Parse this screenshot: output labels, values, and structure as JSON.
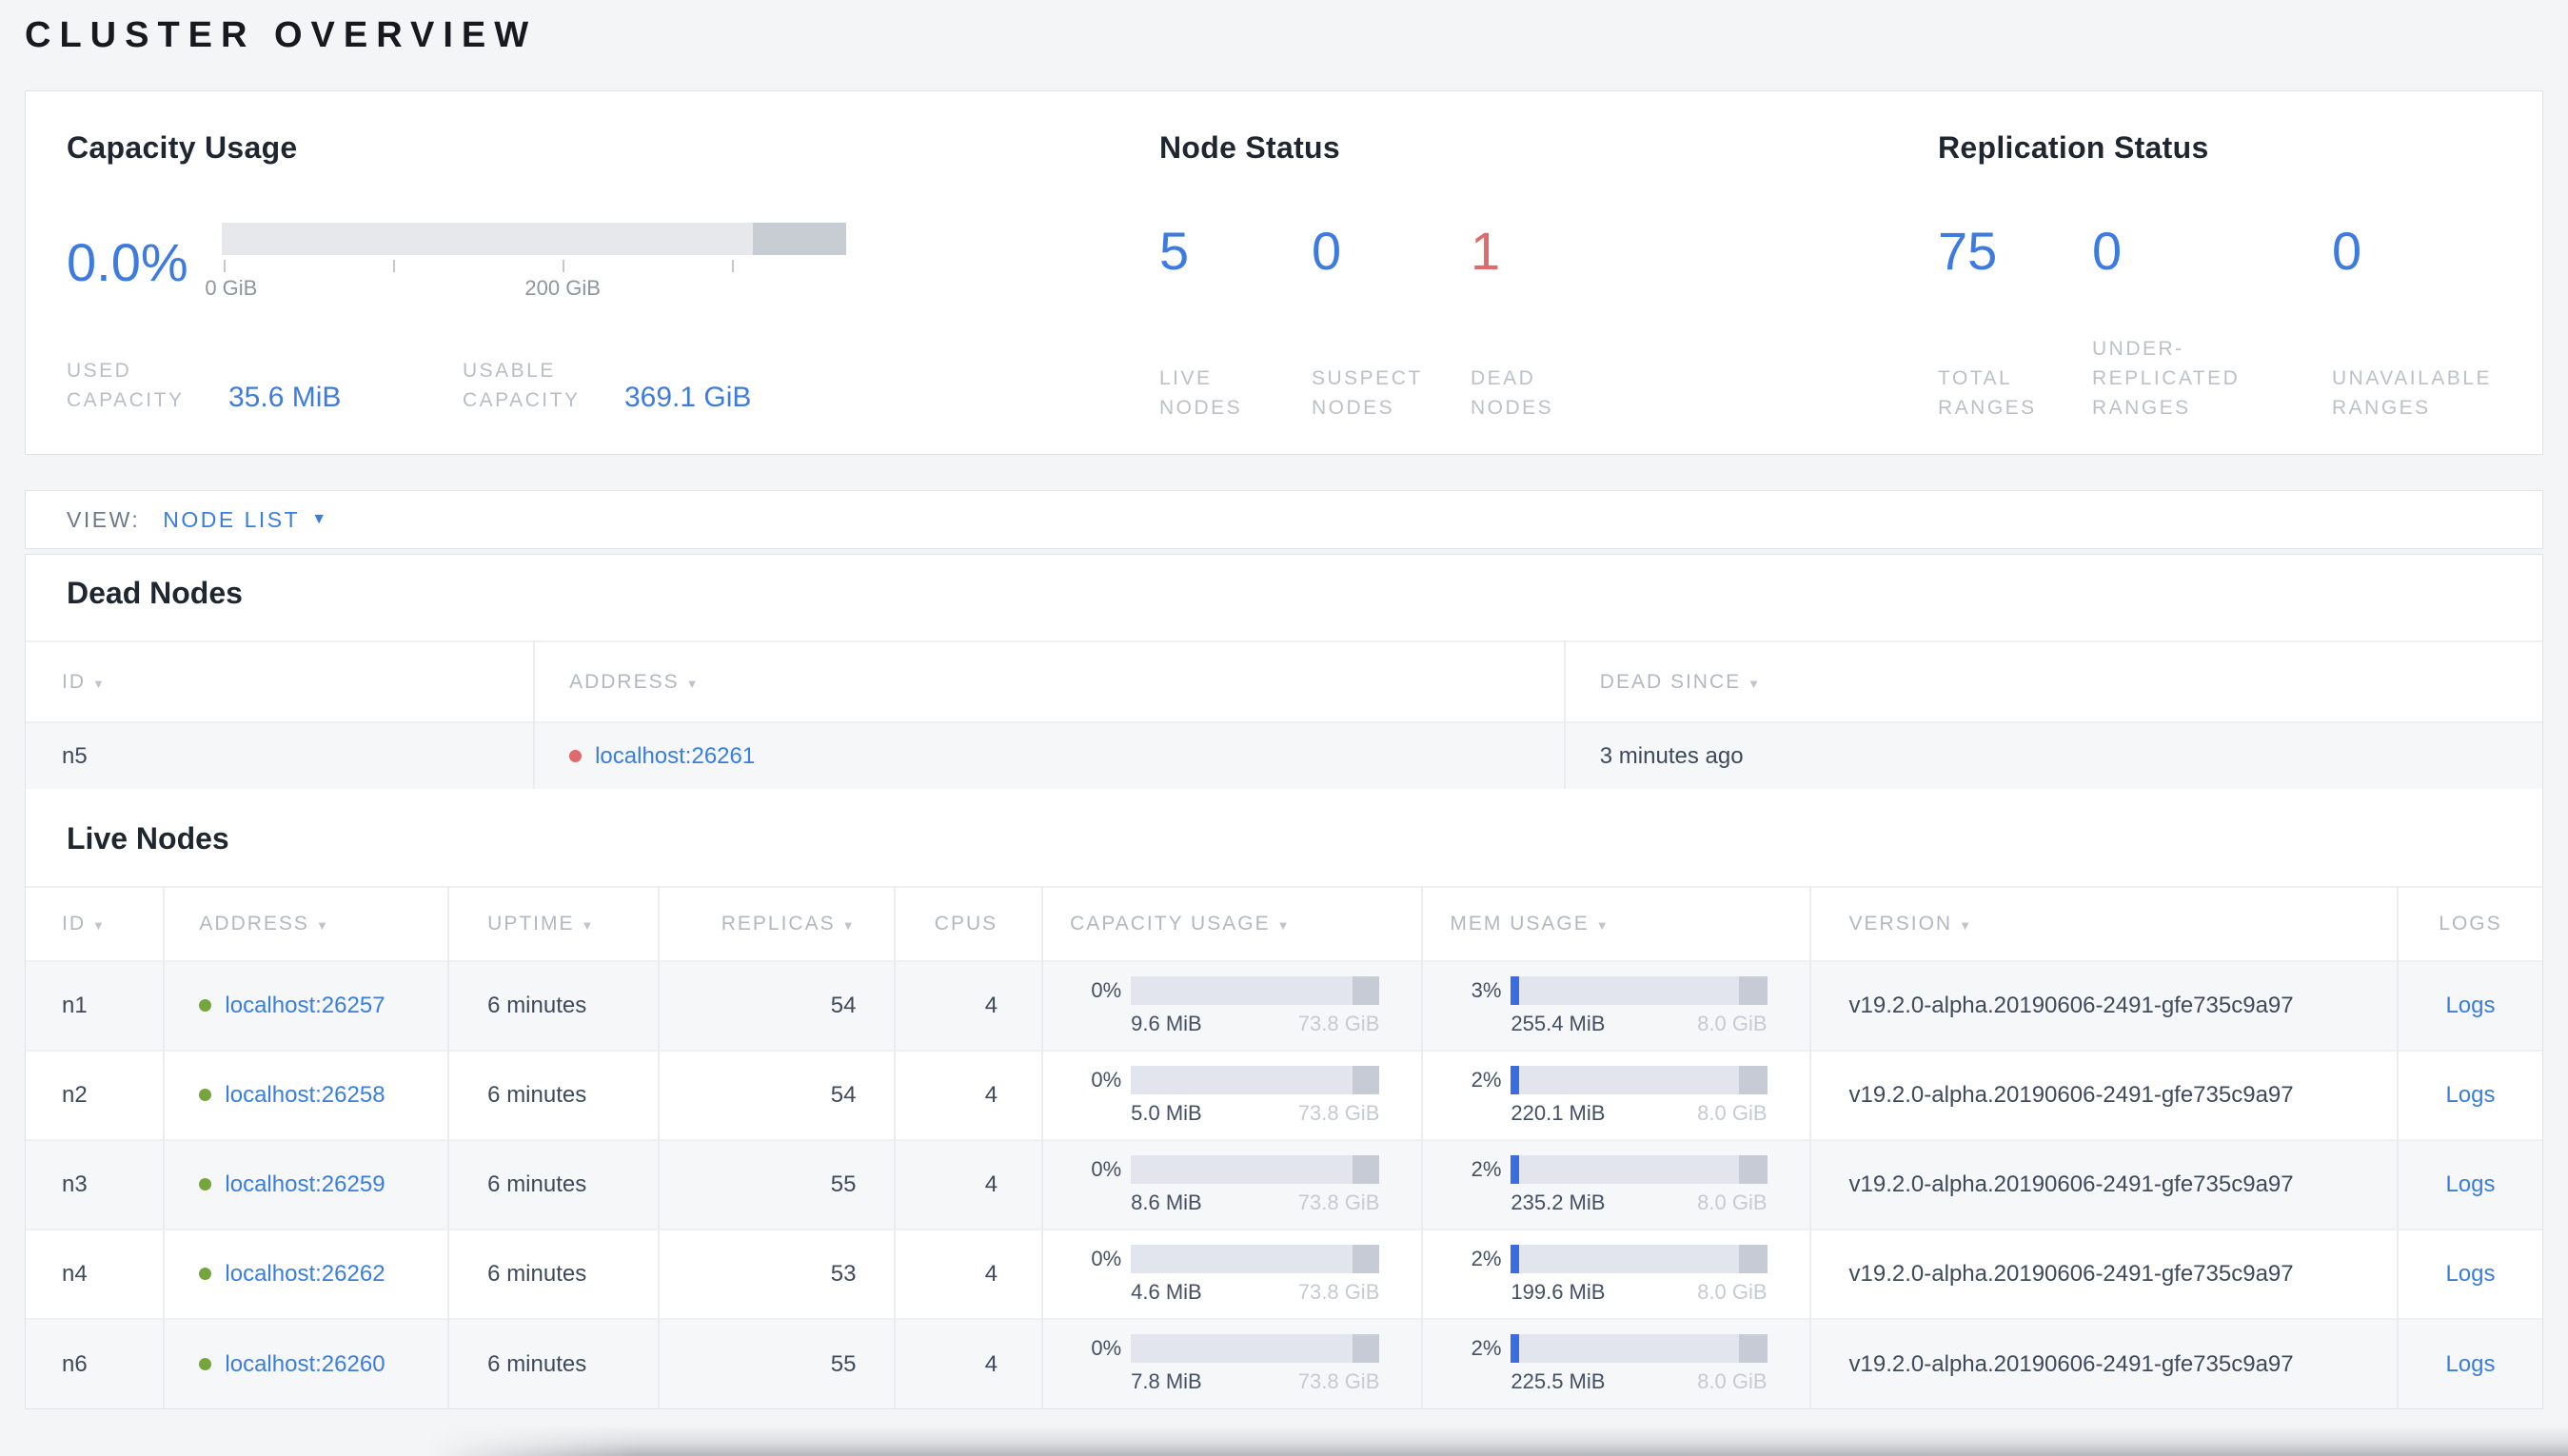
{
  "page": {
    "title": "CLUSTER OVERVIEW"
  },
  "colors": {
    "accent_blue": "#3a7de1",
    "number_blue": "#3d7be0",
    "danger_red": "#e0696e",
    "live_green": "#76a53e",
    "label_gray": "#b9bec6",
    "text_dark": "#3f495c"
  },
  "summary": {
    "capacity": {
      "title": "Capacity Usage",
      "percent": "0.0%",
      "tick_label_0": "0 GiB",
      "tick_label_200": "200 GiB",
      "used_label": "USED\nCAPACITY",
      "used_value": "35.6 MiB",
      "usable_label": "USABLE\nCAPACITY",
      "usable_value": "369.1 GiB"
    },
    "node_status": {
      "title": "Node Status",
      "stats": [
        {
          "value": "5",
          "label": "LIVE\nNODES"
        },
        {
          "value": "0",
          "label": "SUSPECT\nNODES"
        },
        {
          "value": "1",
          "label": "DEAD\nNODES"
        }
      ]
    },
    "replication": {
      "title": "Replication Status",
      "stats": [
        {
          "value": "75",
          "label": "TOTAL\nRANGES"
        },
        {
          "value": "0",
          "label": "UNDER-\nREPLICATED\nRANGES"
        },
        {
          "value": "0",
          "label": "UNAVAILABLE\nRANGES"
        }
      ]
    }
  },
  "view_bar": {
    "label": "VIEW:",
    "value": "NODE LIST"
  },
  "dead_nodes": {
    "title": "Dead Nodes",
    "headers": [
      "ID",
      "ADDRESS",
      "DEAD SINCE"
    ],
    "row": {
      "id": "n5",
      "address": "localhost:26261",
      "dead_since": "3 minutes ago"
    }
  },
  "live_nodes": {
    "title": "Live Nodes",
    "headers": [
      "ID",
      "ADDRESS",
      "UPTIME",
      "REPLICAS",
      "CPUS",
      "CAPACITY USAGE",
      "MEM USAGE",
      "VERSION",
      "LOGS"
    ],
    "rows": [
      {
        "id": "n1",
        "address": "localhost:26257",
        "uptime": "6 minutes",
        "replicas": "54",
        "cpus": "4",
        "capacity": {
          "percent": "0%",
          "fill": "0%",
          "used": "9.6 MiB",
          "total": "73.8 GiB"
        },
        "memory": {
          "percent": "3%",
          "fill": "3%",
          "used": "255.4 MiB",
          "total": "8.0 GiB"
        },
        "version": "v19.2.0-alpha.20190606-2491-gfe735c9a97",
        "logs": "Logs"
      },
      {
        "id": "n2",
        "address": "localhost:26258",
        "uptime": "6 minutes",
        "replicas": "54",
        "cpus": "4",
        "capacity": {
          "percent": "0%",
          "fill": "0%",
          "used": "5.0 MiB",
          "total": "73.8 GiB"
        },
        "memory": {
          "percent": "2%",
          "fill": "2%",
          "used": "220.1 MiB",
          "total": "8.0 GiB"
        },
        "version": "v19.2.0-alpha.20190606-2491-gfe735c9a97",
        "logs": "Logs"
      },
      {
        "id": "n3",
        "address": "localhost:26259",
        "uptime": "6 minutes",
        "replicas": "55",
        "cpus": "4",
        "capacity": {
          "percent": "0%",
          "fill": "0%",
          "used": "8.6 MiB",
          "total": "73.8 GiB"
        },
        "memory": {
          "percent": "2%",
          "fill": "2%",
          "used": "235.2 MiB",
          "total": "8.0 GiB"
        },
        "version": "v19.2.0-alpha.20190606-2491-gfe735c9a97",
        "logs": "Logs"
      },
      {
        "id": "n4",
        "address": "localhost:26262",
        "uptime": "6 minutes",
        "replicas": "53",
        "cpus": "4",
        "capacity": {
          "percent": "0%",
          "fill": "0%",
          "used": "4.6 MiB",
          "total": "73.8 GiB"
        },
        "memory": {
          "percent": "2%",
          "fill": "2%",
          "used": "199.6 MiB",
          "total": "8.0 GiB"
        },
        "version": "v19.2.0-alpha.20190606-2491-gfe735c9a97",
        "logs": "Logs"
      },
      {
        "id": "n6",
        "address": "localhost:26260",
        "uptime": "6 minutes",
        "replicas": "55",
        "cpus": "4",
        "capacity": {
          "percent": "0%",
          "fill": "0%",
          "used": "7.8 MiB",
          "total": "73.8 GiB"
        },
        "memory": {
          "percent": "2%",
          "fill": "2%",
          "used": "225.5 MiB",
          "total": "8.0 GiB"
        },
        "version": "v19.2.0-alpha.20190606-2491-gfe735c9a97",
        "logs": "Logs"
      }
    ]
  }
}
